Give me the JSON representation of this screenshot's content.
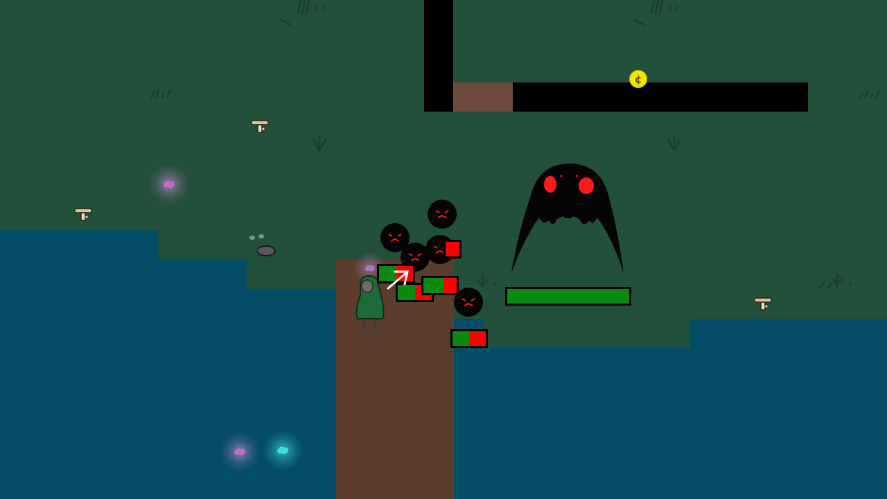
{
  "player": {
    "health": 0.5
  },
  "boss": {
    "health": 1.0
  },
  "minions": [
    {
      "health": 0.5
    },
    {
      "health": 0.5
    },
    {
      "health": 0.6
    },
    {
      "health": 0.5
    },
    {
      "health": 0.5
    }
  ],
  "coin": {
    "symbol": "¢"
  },
  "colors": {
    "grass": "#23503b",
    "water": "#034d66",
    "path": "#5a3e2b",
    "wall": "#000000",
    "health_full": "#0b8a12",
    "health_empty": "#ff0000",
    "coin": "#f2e500",
    "enemy_eyes": "#ff1a1a"
  },
  "icons": [
    "mushroom-icon",
    "herb-icon",
    "glow-flower-icon",
    "coin-icon",
    "grass-tuft-icon",
    "aim-arrow-icon"
  ]
}
